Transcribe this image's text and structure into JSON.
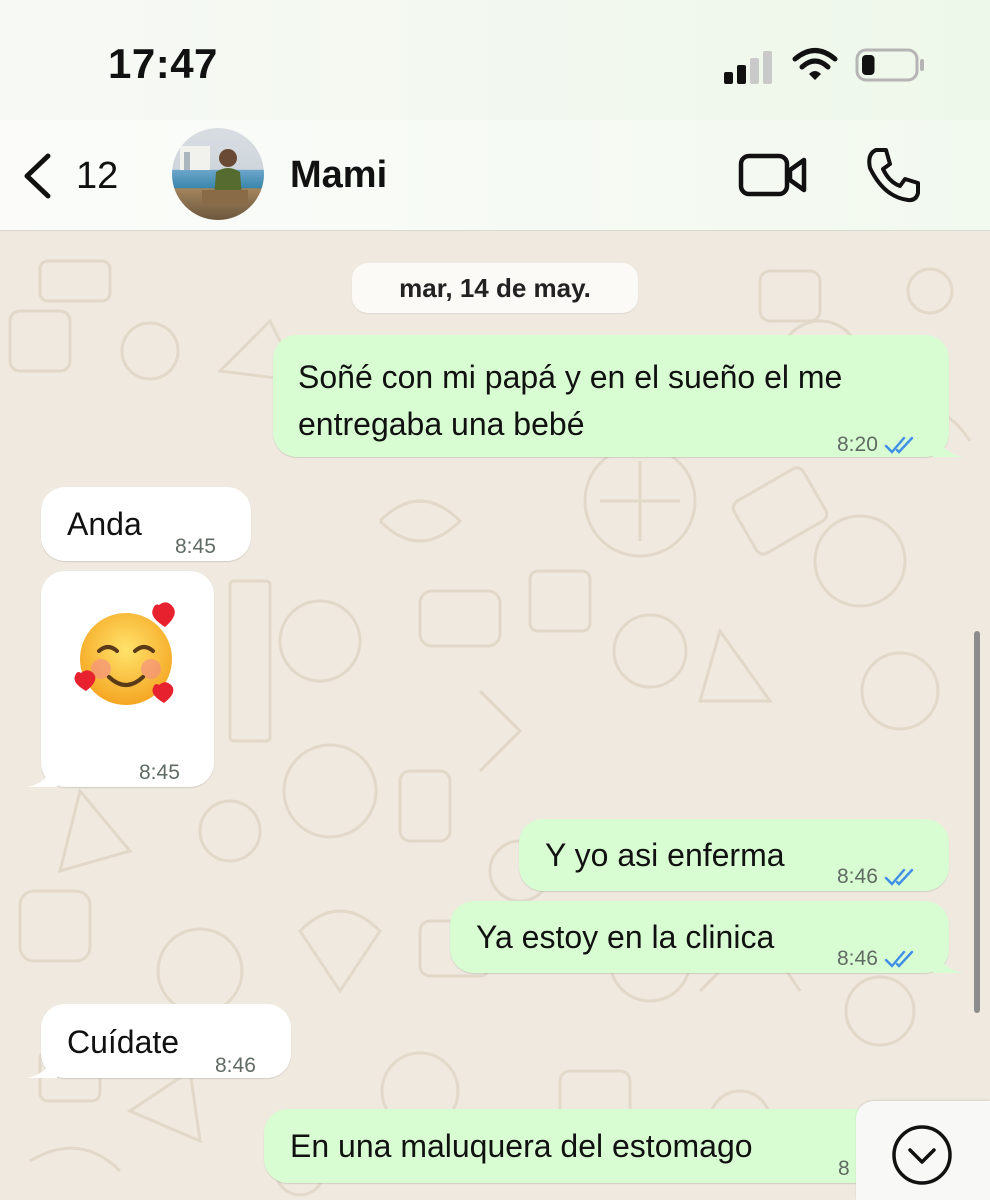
{
  "status_bar": {
    "time": "17:47",
    "signal_icon": "cellular-signal-icon",
    "wifi_icon": "wifi-icon",
    "battery_icon": "battery-icon",
    "battery_level": 0.25
  },
  "header": {
    "back_icon": "chevron-left-icon",
    "unread_count": "12",
    "contact_name": "Mami",
    "video_icon": "video-call-icon",
    "call_icon": "phone-icon"
  },
  "chat": {
    "date_label": "mar, 14 de may.",
    "messages": [
      {
        "direction": "out",
        "text_line1": "Soñé con mi papá y en el sueño el me",
        "text_line2": "entregaba una bebé",
        "time": "8:20",
        "status": "read"
      },
      {
        "direction": "in",
        "text": "Anda",
        "time": "8:45"
      },
      {
        "direction": "in",
        "emoji": "smiling-face-with-hearts-icon",
        "time": "8:45"
      },
      {
        "direction": "out",
        "text": "Y yo asi enferma",
        "time": "8:46",
        "status": "read"
      },
      {
        "direction": "out",
        "text": "Ya estoy en la clinica",
        "time": "8:46",
        "status": "read"
      },
      {
        "direction": "in",
        "text": "Cuídate",
        "time": "8:46"
      },
      {
        "direction": "out",
        "text": "En una maluquera del estomago",
        "time": "8"
      }
    ]
  },
  "scroll_down_icon": "chevron-down-circle-icon",
  "colors": {
    "outgoing_bubble": "#d9fdd3",
    "incoming_bubble": "#ffffff",
    "read_ticks": "#3f8ee8",
    "wallpaper": "#efe9df"
  }
}
